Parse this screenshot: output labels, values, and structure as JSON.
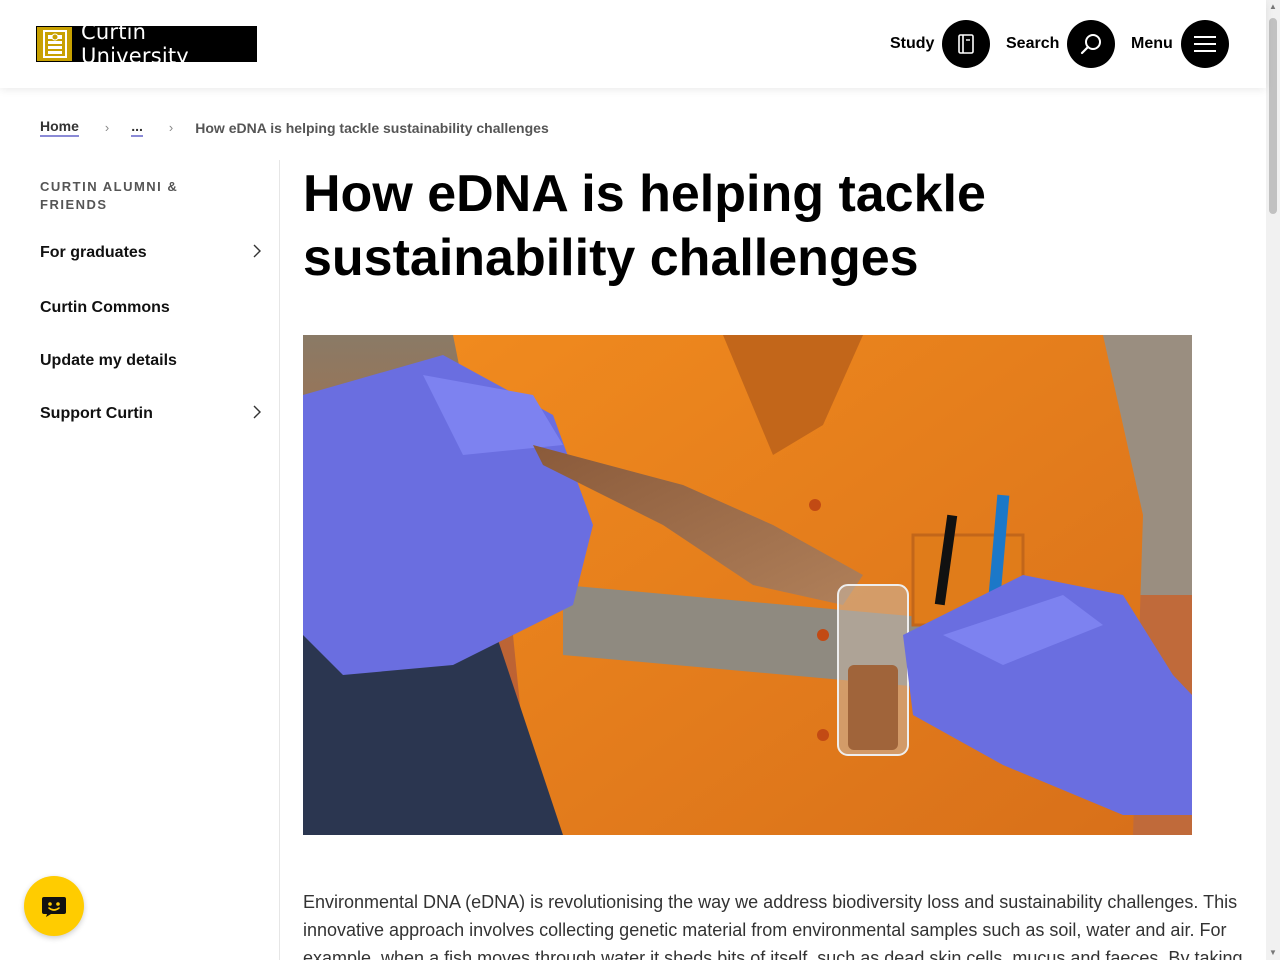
{
  "header": {
    "logo_text": "Curtin University",
    "study_label": "Study",
    "search_label": "Search",
    "menu_label": "Menu"
  },
  "breadcrumb": {
    "home": "Home",
    "ellipsis": "...",
    "current": "How eDNA is helping tackle sustainability challenges"
  },
  "sidebar": {
    "title": "Curtin Alumni & Friends",
    "items": [
      {
        "label": "For graduates",
        "has_children": true
      },
      {
        "label": "Curtin Commons",
        "has_children": false
      },
      {
        "label": "Update my details",
        "has_children": false
      },
      {
        "label": "Support Curtin",
        "has_children": true
      }
    ]
  },
  "article": {
    "title": "How eDNA is helping tackle sustainability challenges",
    "intro": "Environmental DNA (eDNA) is revolutionising the way we address biodiversity loss and sustainability challenges. This innovative approach involves collecting genetic material from environmental samples such as soil, water and air. For example, when a fish moves through water it sheds bits of itself, such as dead skin cells, mucus and faeces. By taking"
  },
  "colors": {
    "brand_gold": "#c8a100",
    "chat_yellow": "#ffcc00",
    "breadcrumb_underline": "#8a8ad6"
  }
}
